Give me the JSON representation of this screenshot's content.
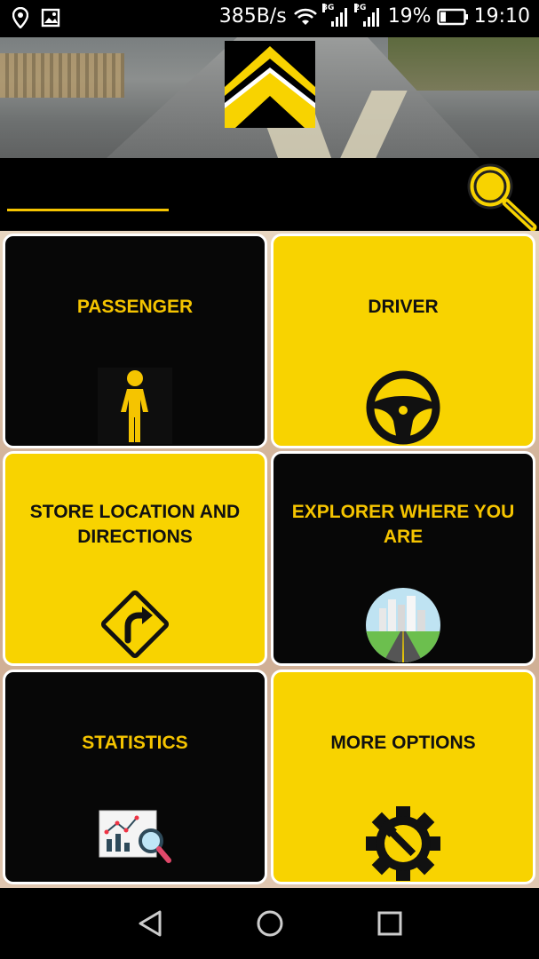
{
  "status_bar": {
    "speed": "385B/s",
    "sim1_tag": "3G",
    "sim2_tag": "2G",
    "battery": "19%",
    "time": "19:10",
    "icons": [
      "location-icon",
      "image-icon",
      "wifi-icon",
      "signal-icon",
      "battery-icon"
    ]
  },
  "search": {
    "value": "",
    "placeholder": "",
    "accent": "#f5c400"
  },
  "tiles": [
    {
      "label": "PASSENGER",
      "icon": "person-icon",
      "theme": "dark"
    },
    {
      "label": "DRIVER",
      "icon": "steering-wheel-icon",
      "theme": "yellow"
    },
    {
      "label": "STORE LOCATION AND DIRECTIONS",
      "icon": "turn-right-sign-icon",
      "theme": "yellow"
    },
    {
      "label": "EXPLORER WHERE YOU ARE",
      "icon": "city-road-icon",
      "theme": "dark"
    },
    {
      "label": "STATISTICS",
      "icon": "chart-magnifier-icon",
      "theme": "dark"
    },
    {
      "label": "MORE OPTIONS",
      "icon": "gear-wrench-icon",
      "theme": "yellow"
    }
  ],
  "colors": {
    "brand_yellow": "#f8d300",
    "dark_tile": "#070707",
    "label_yellow": "#f5c400"
  },
  "nav": {
    "icons": [
      "back-icon",
      "home-icon",
      "recents-icon"
    ]
  }
}
